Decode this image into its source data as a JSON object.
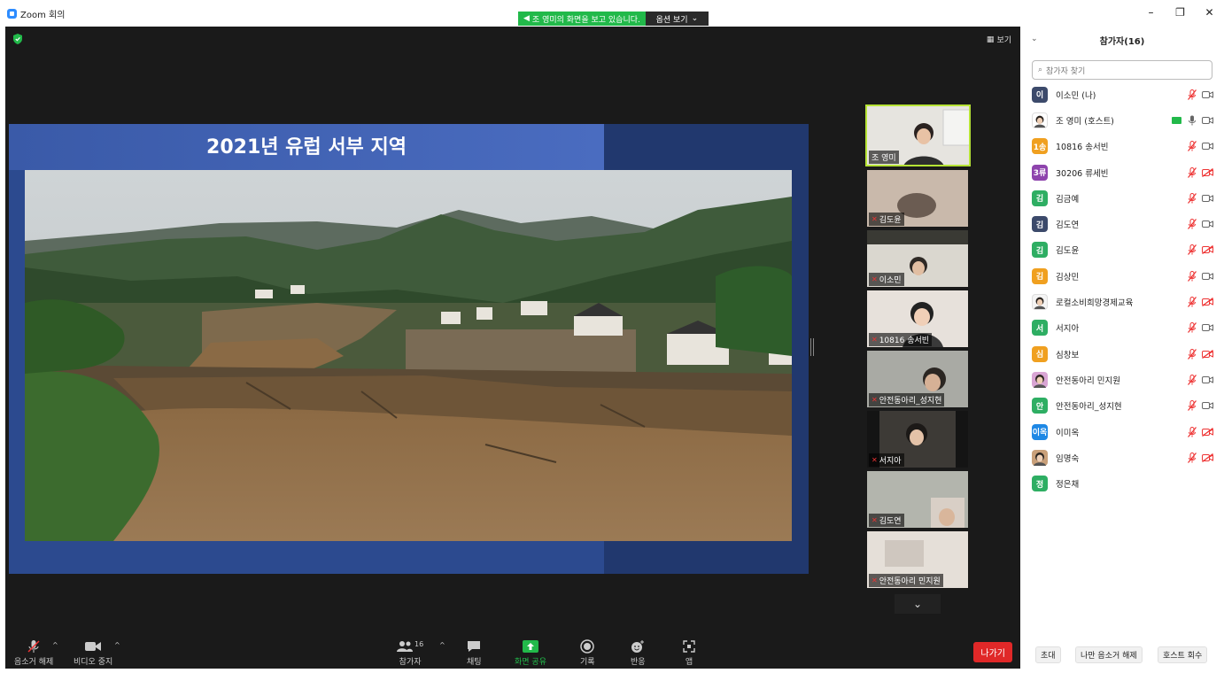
{
  "window": {
    "title": "Zoom 회의",
    "minimize": "–",
    "maximize": "❐",
    "close": "✕"
  },
  "share_banner": {
    "status": "조 영미의 화면을 보고 있습니다.",
    "options": "옵션 보기"
  },
  "view_button": {
    "label": "보기"
  },
  "slide": {
    "title": "2021년 유럽 서부 지역"
  },
  "thumbnails": [
    {
      "name": "조 영미",
      "muted": false
    },
    {
      "name": "김도윤",
      "muted": true
    },
    {
      "name": "이소민",
      "muted": true
    },
    {
      "name": "10816 송서빈",
      "muted": true
    },
    {
      "name": "안전동아리_성지현",
      "muted": true
    },
    {
      "name": "서지아",
      "muted": true
    },
    {
      "name": "김도연",
      "muted": true
    },
    {
      "name": "안전동아리 민지원",
      "muted": true
    }
  ],
  "toolbar": {
    "mute": "음소거 해제",
    "video": "비디오 중지",
    "participants": "참가자",
    "participants_count": "16",
    "chat": "채팅",
    "share": "화면 공유",
    "record": "기록",
    "reactions": "반응",
    "apps": "앱",
    "leave": "나가기"
  },
  "panel": {
    "title": "참가자(16)",
    "search_placeholder": "참가자 찾기",
    "participants": [
      {
        "avatar": "이",
        "color": "#3C4A6B",
        "name": "이소민 (나)",
        "cam_off": false
      },
      {
        "avatar": "",
        "color": "#ffffff",
        "name": "조 영미 (호스트)",
        "cam_off": false
      },
      {
        "avatar": "1송",
        "color": "#F0A020",
        "name": "10816 송서빈",
        "cam_off": false
      },
      {
        "avatar": "3류",
        "color": "#8E44AD",
        "name": "30206 류세빈",
        "cam_off": true
      },
      {
        "avatar": "김",
        "color": "#2EAE63",
        "name": "김금예",
        "cam_off": false
      },
      {
        "avatar": "김",
        "color": "#3C4A6B",
        "name": "김도연",
        "cam_off": false
      },
      {
        "avatar": "김",
        "color": "#2EAE63",
        "name": "김도윤",
        "cam_off": true
      },
      {
        "avatar": "김",
        "color": "#F0A020",
        "name": "김상민",
        "cam_off": false
      },
      {
        "avatar": "",
        "color": "#f4f4f4",
        "name": "로컬소비희망경제교육",
        "cam_off": true
      },
      {
        "avatar": "서",
        "color": "#2EAE63",
        "name": "서지아",
        "cam_off": false
      },
      {
        "avatar": "심",
        "color": "#F0A020",
        "name": "심창보",
        "cam_off": true
      },
      {
        "avatar": "",
        "color": "#d9a5d4",
        "name": "안전동아리 민지원",
        "cam_off": false
      },
      {
        "avatar": "안",
        "color": "#2EAE63",
        "name": "안전동아리_성지현",
        "cam_off": false
      },
      {
        "avatar": "이옥",
        "color": "#1E88E5",
        "name": "이미옥",
        "cam_off": true
      },
      {
        "avatar": "",
        "color": "#c9a07a",
        "name": "임명숙",
        "cam_off": true
      },
      {
        "avatar": "정",
        "color": "#2EAE63",
        "name": "정은채",
        "cam_off": null
      }
    ],
    "footer": {
      "invite": "초대",
      "mute_all": "나만 음소거 해제",
      "host_reclaim": "호스트 회수"
    }
  }
}
